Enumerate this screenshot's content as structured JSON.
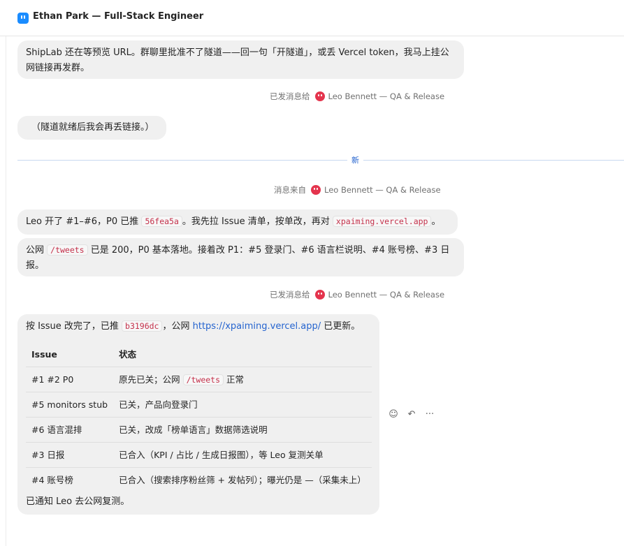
{
  "header": {
    "title": "Ethan Park — Full-Stack Engineer"
  },
  "messages": {
    "m1": {
      "text": "ShipLab 还在等预览 URL。群聊里批准不了隧道——回一句「开隧道」，或丢 Vercel token，我马上挂公网链接再发群。"
    },
    "meta1": {
      "prefix": "已发消息给",
      "name": "Leo Bennett — QA & Release"
    },
    "m2": {
      "text": "（隧道就绪后我会再丢链接。）"
    },
    "divider": {
      "label": "新"
    },
    "meta2": {
      "prefix": "消息来自",
      "name": "Leo Bennett — QA & Release"
    },
    "m3": {
      "a": "Leo 开了 #1–#6，P0 已推 ",
      "code1": "56fea5a",
      "b": "。我先拉 Issue 清单，按单改，再对 ",
      "code2": "xpaiming.vercel.app",
      "c": "。"
    },
    "m4": {
      "a": "公网 ",
      "code": "/tweets",
      "b": " 已是 200，P0 基本落地。接着改 P1：#5 登录门、#6 语言栏说明、#4 账号榜、#3 日报。"
    },
    "meta3": {
      "prefix": "已发消息给",
      "name": "Leo Bennett — QA & Release"
    },
    "m5": {
      "a": "按 Issue 改完了，已推 ",
      "code": "b3196dc",
      "b": "，公网 ",
      "link": "https://xpaiming.vercel.app/",
      "c": " 已更新。",
      "table": {
        "headers": [
          "Issue",
          "状态"
        ],
        "rows": [
          {
            "issue": "#1 #2 P0",
            "status_a": "原先已关；公网 ",
            "status_code": "/tweets",
            "status_b": " 正常"
          },
          {
            "issue": "#5 monitors stub",
            "status": "已关，产品向登录门"
          },
          {
            "issue": "#6 语言混排",
            "status": "已关，改成「榜单语言」数据筛选说明"
          },
          {
            "issue": "#3 日报",
            "status": "已合入（KPI / 占比 / 生成日报图），等 Leo 复测关单"
          },
          {
            "issue": "#4 账号榜",
            "status": "已合入（搜索排序粉丝筛 + 发帖列）；曝光仍是 —（采集未上）"
          }
        ]
      },
      "footer": "已通知 Leo 去公网复测。"
    }
  },
  "actions": {
    "react": "☺",
    "reply": "↶",
    "more": "···"
  },
  "colors": {
    "accent": "#2564cf",
    "avatar": "#e4344d",
    "app_icon": "#1a8cff",
    "code": "#c4314b"
  }
}
